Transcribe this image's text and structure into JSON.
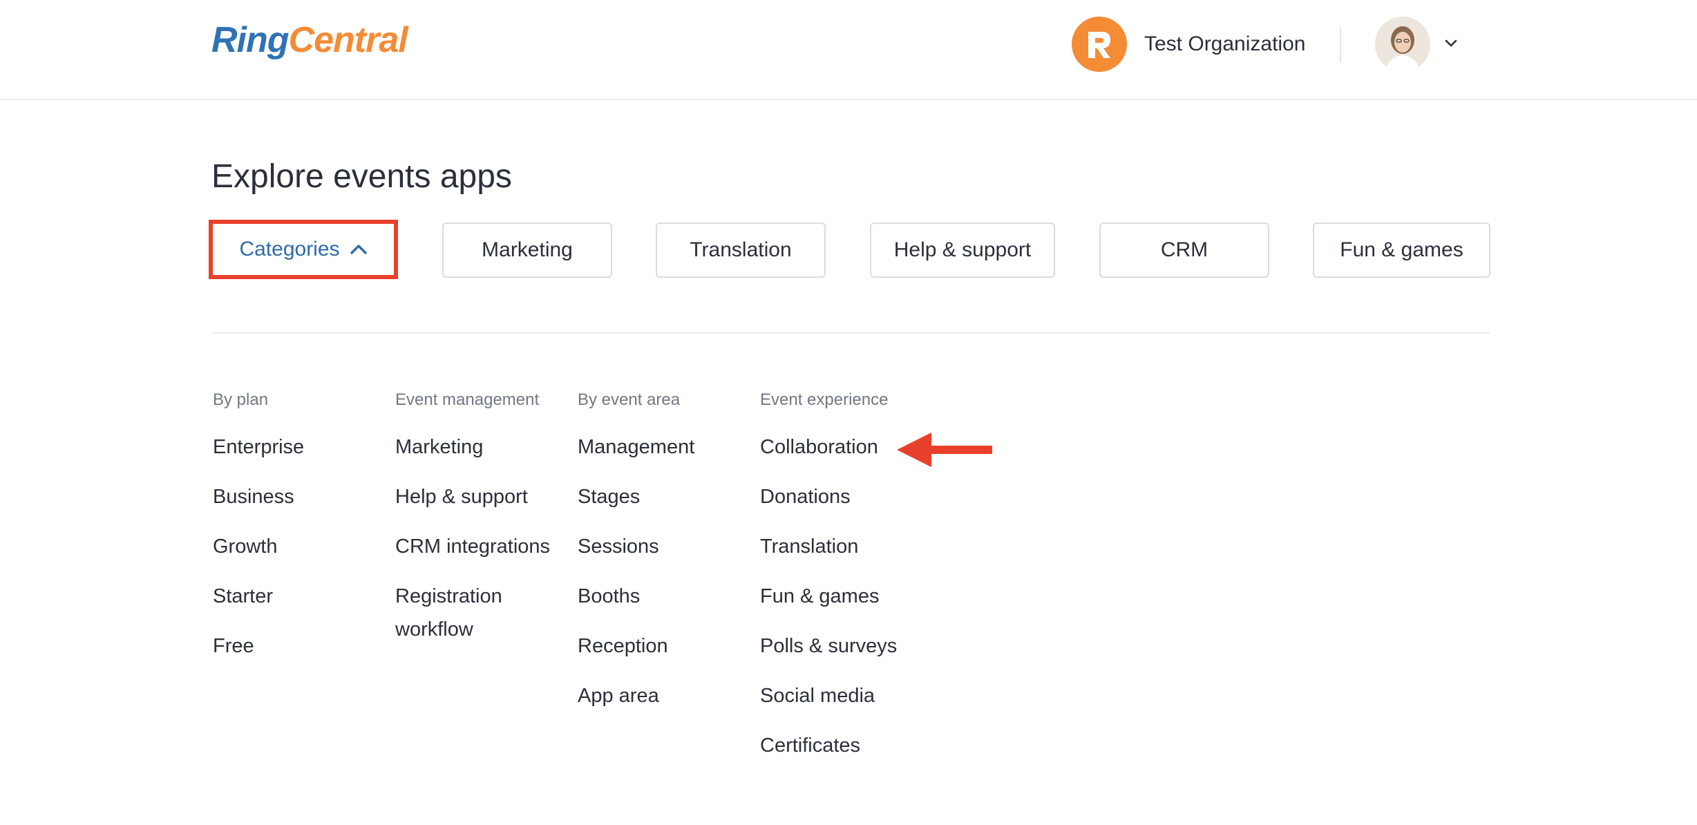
{
  "header": {
    "logo_part1": "Ring",
    "logo_part2": "Central",
    "org_name": "Test Organization"
  },
  "main": {
    "title": "Explore events apps",
    "chips": [
      {
        "label": "Categories"
      },
      {
        "label": "Marketing"
      },
      {
        "label": "Translation"
      },
      {
        "label": "Help & support"
      },
      {
        "label": "CRM"
      },
      {
        "label": "Fun & games"
      }
    ],
    "columns": [
      {
        "heading": "By plan",
        "items": [
          "Enterprise",
          "Business",
          "Growth",
          "Starter",
          "Free"
        ]
      },
      {
        "heading": "Event management",
        "items": [
          "Marketing",
          "Help & support",
          "CRM integrations",
          "Registration workflow"
        ]
      },
      {
        "heading": "By event area",
        "items": [
          "Management",
          "Stages",
          "Sessions",
          "Booths",
          "Reception",
          "App area"
        ]
      },
      {
        "heading": "Event experience",
        "items": [
          "Collaboration",
          "Donations",
          "Translation",
          "Fun & games",
          "Polls & surveys",
          "Social media",
          "Certificates"
        ]
      }
    ]
  },
  "colors": {
    "brand_blue": "#2f73b6",
    "brand_orange": "#f48b35",
    "highlight_red": "#e8402a"
  },
  "icons": {
    "org": "r-logo-icon",
    "user": "user-avatar",
    "dropdown": "chevron-down-icon",
    "categories_toggle": "chevron-up-icon",
    "annotation": "arrow-left-icon"
  }
}
